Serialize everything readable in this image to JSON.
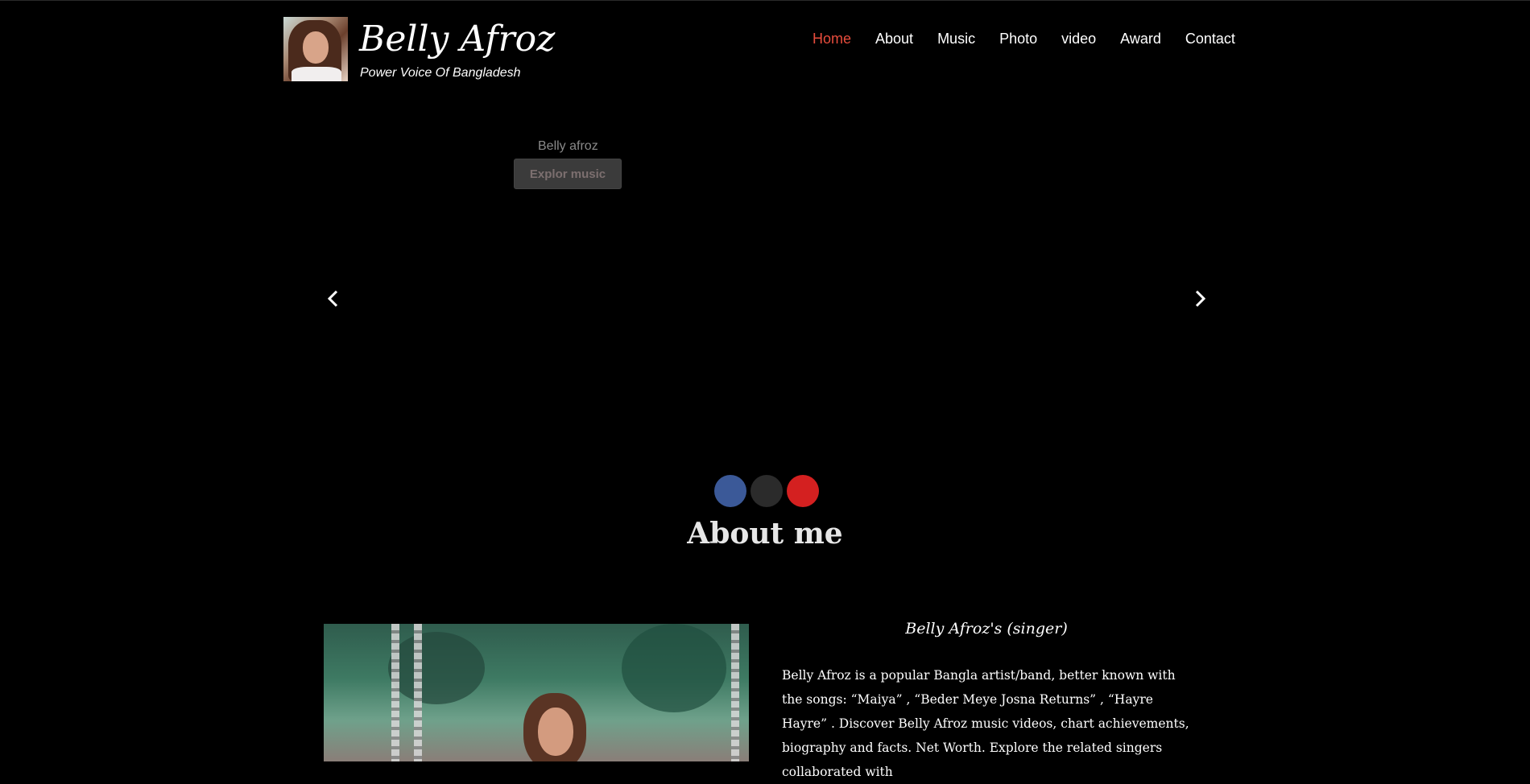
{
  "header": {
    "brand_name": "Belly Afroz",
    "tagline": "Power Voice Of Bangladesh",
    "nav": [
      {
        "label": "Home",
        "active": true
      },
      {
        "label": "About"
      },
      {
        "label": "Music"
      },
      {
        "label": "Photo"
      },
      {
        "label": "video"
      },
      {
        "label": "Award"
      },
      {
        "label": "Contact"
      }
    ]
  },
  "slider": {
    "caption": "Belly afroz",
    "button_label": "Explor music"
  },
  "social": {
    "colors": {
      "facebook": "#3b5998",
      "twitter": "#2b2b2b",
      "youtube": "#d42020"
    }
  },
  "about": {
    "title": "About me",
    "subtitle": "Belly Afroz's (singer)",
    "bio": "Belly Afroz is a popular Bangla artist/band, better known with the songs: “Maiya” , “Beder Meye Josna Returns” , “Hayre Hayre” . Discover Belly Afroz music videos, chart achievements, biography and facts. Net Worth. Explore the related singers collaborated with"
  },
  "colors": {
    "accent": "#e74c3c",
    "background": "#000000"
  }
}
